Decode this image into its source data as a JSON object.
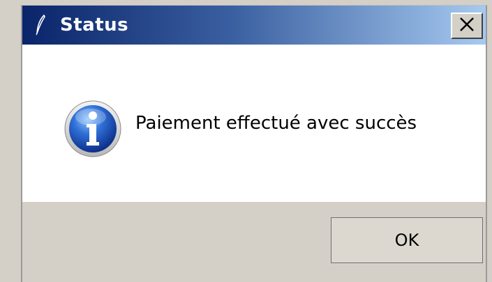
{
  "dialog": {
    "title": "Status",
    "title_icon": "feather-icon",
    "close_icon": "close-icon",
    "message": "Paiement effectué avec succès",
    "message_icon": "info-icon",
    "ok_label": "OK"
  },
  "colors": {
    "titlebar_start": "#0a246a",
    "titlebar_end": "#a6caf0",
    "button_face": "#d4d0c8",
    "content_bg": "#ffffff"
  }
}
